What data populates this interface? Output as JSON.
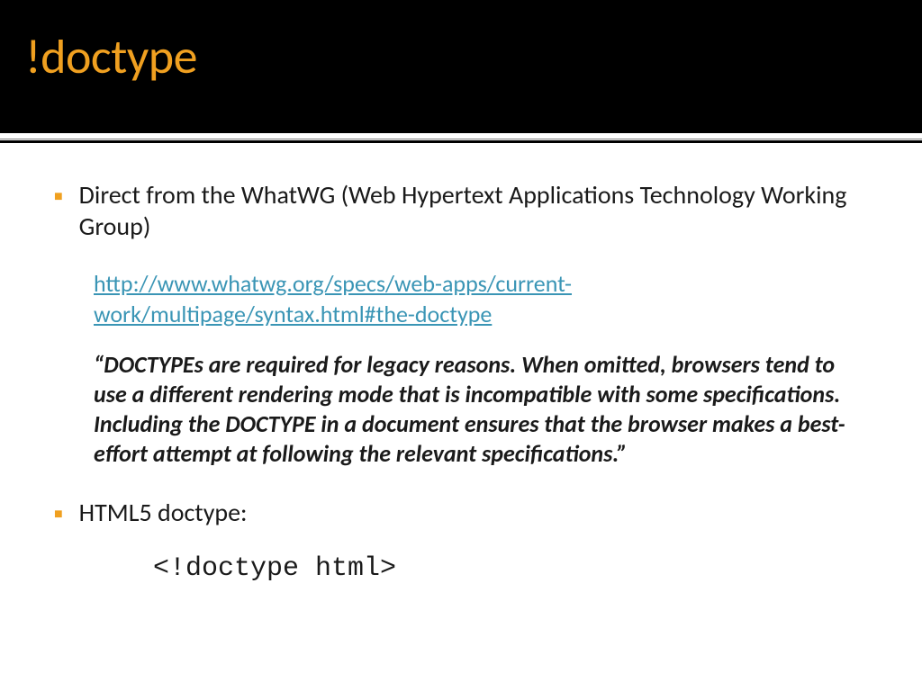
{
  "header": {
    "title": "!doctype"
  },
  "bullets": {
    "item1": "Direct from the WhatWG (Web Hypertext Applications Technology Working Group)",
    "item2": "HTML5 doctype:"
  },
  "link": {
    "url": "http://www.whatwg.org/specs/web-apps/current-work/multipage/syntax.html#the-doctype"
  },
  "quote": {
    "text": "“DOCTYPEs are required for legacy reasons. When omitted, browsers tend to use a different rendering mode that is incompatible with some specifications. Including the DOCTYPE in a document ensures that the browser makes a best-effort attempt at following the relevant specifications.”"
  },
  "code": {
    "text": "<!doctype html>"
  }
}
